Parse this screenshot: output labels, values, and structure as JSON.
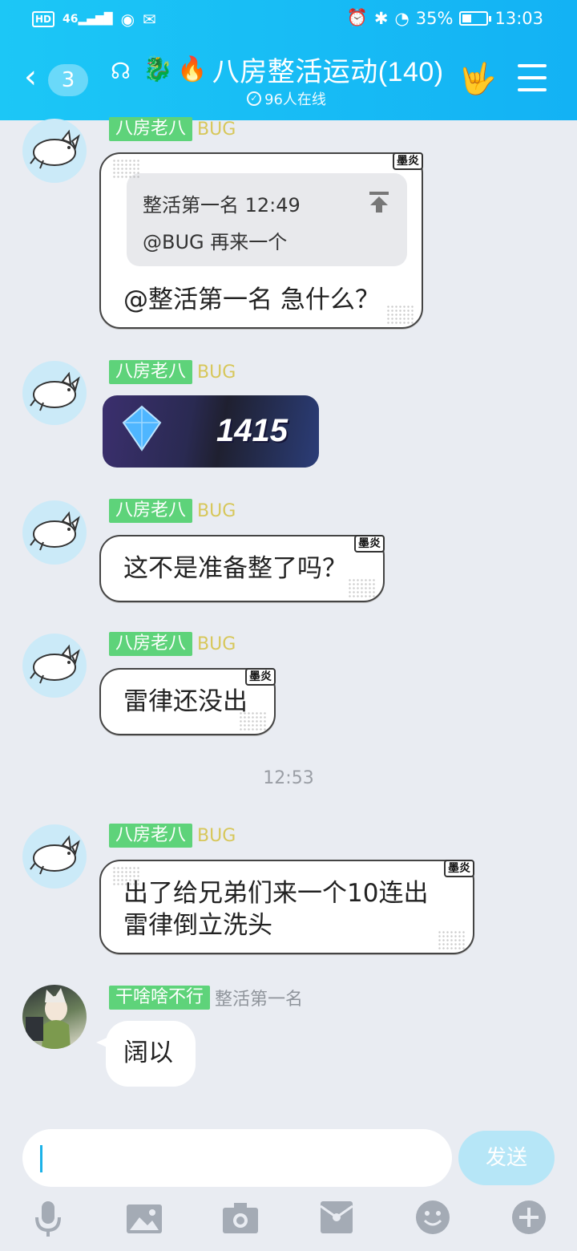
{
  "status_bar": {
    "left": "HD",
    "signal": "46",
    "battery": "35%",
    "time": "13:03"
  },
  "header": {
    "back_count": "3",
    "title": "八房整活运动(140)",
    "online": "96人在线"
  },
  "messages": [
    {
      "tag": "八房老八",
      "user": "BUG",
      "mo": "墨炎",
      "quote_head": "整活第一名 12:49",
      "quote_body": "@BUG 再来一个",
      "text": "@整活第一名  急什么？"
    },
    {
      "tag": "八房老八",
      "user": "BUG",
      "image_number": "1415"
    },
    {
      "tag": "八房老八",
      "user": "BUG",
      "mo": "墨炎",
      "text": "这不是准备整了吗？"
    },
    {
      "tag": "八房老八",
      "user": "BUG",
      "mo": "墨炎",
      "text": "雷律还没出"
    },
    {
      "tag": "八房老八",
      "user": "BUG",
      "mo": "墨炎",
      "text_line1": "出了给兄弟们来一个10连出",
      "text_line2": "雷律倒立洗头"
    },
    {
      "tag": "干啥啥不行",
      "user": "整活第一名",
      "text": "阔以"
    }
  ],
  "timestamp": "12:53",
  "input": {
    "send_label": "发送"
  },
  "colors": {
    "header": "#13b2f4",
    "tag_green": "#5ed37a",
    "background": "#e9ecf2"
  }
}
